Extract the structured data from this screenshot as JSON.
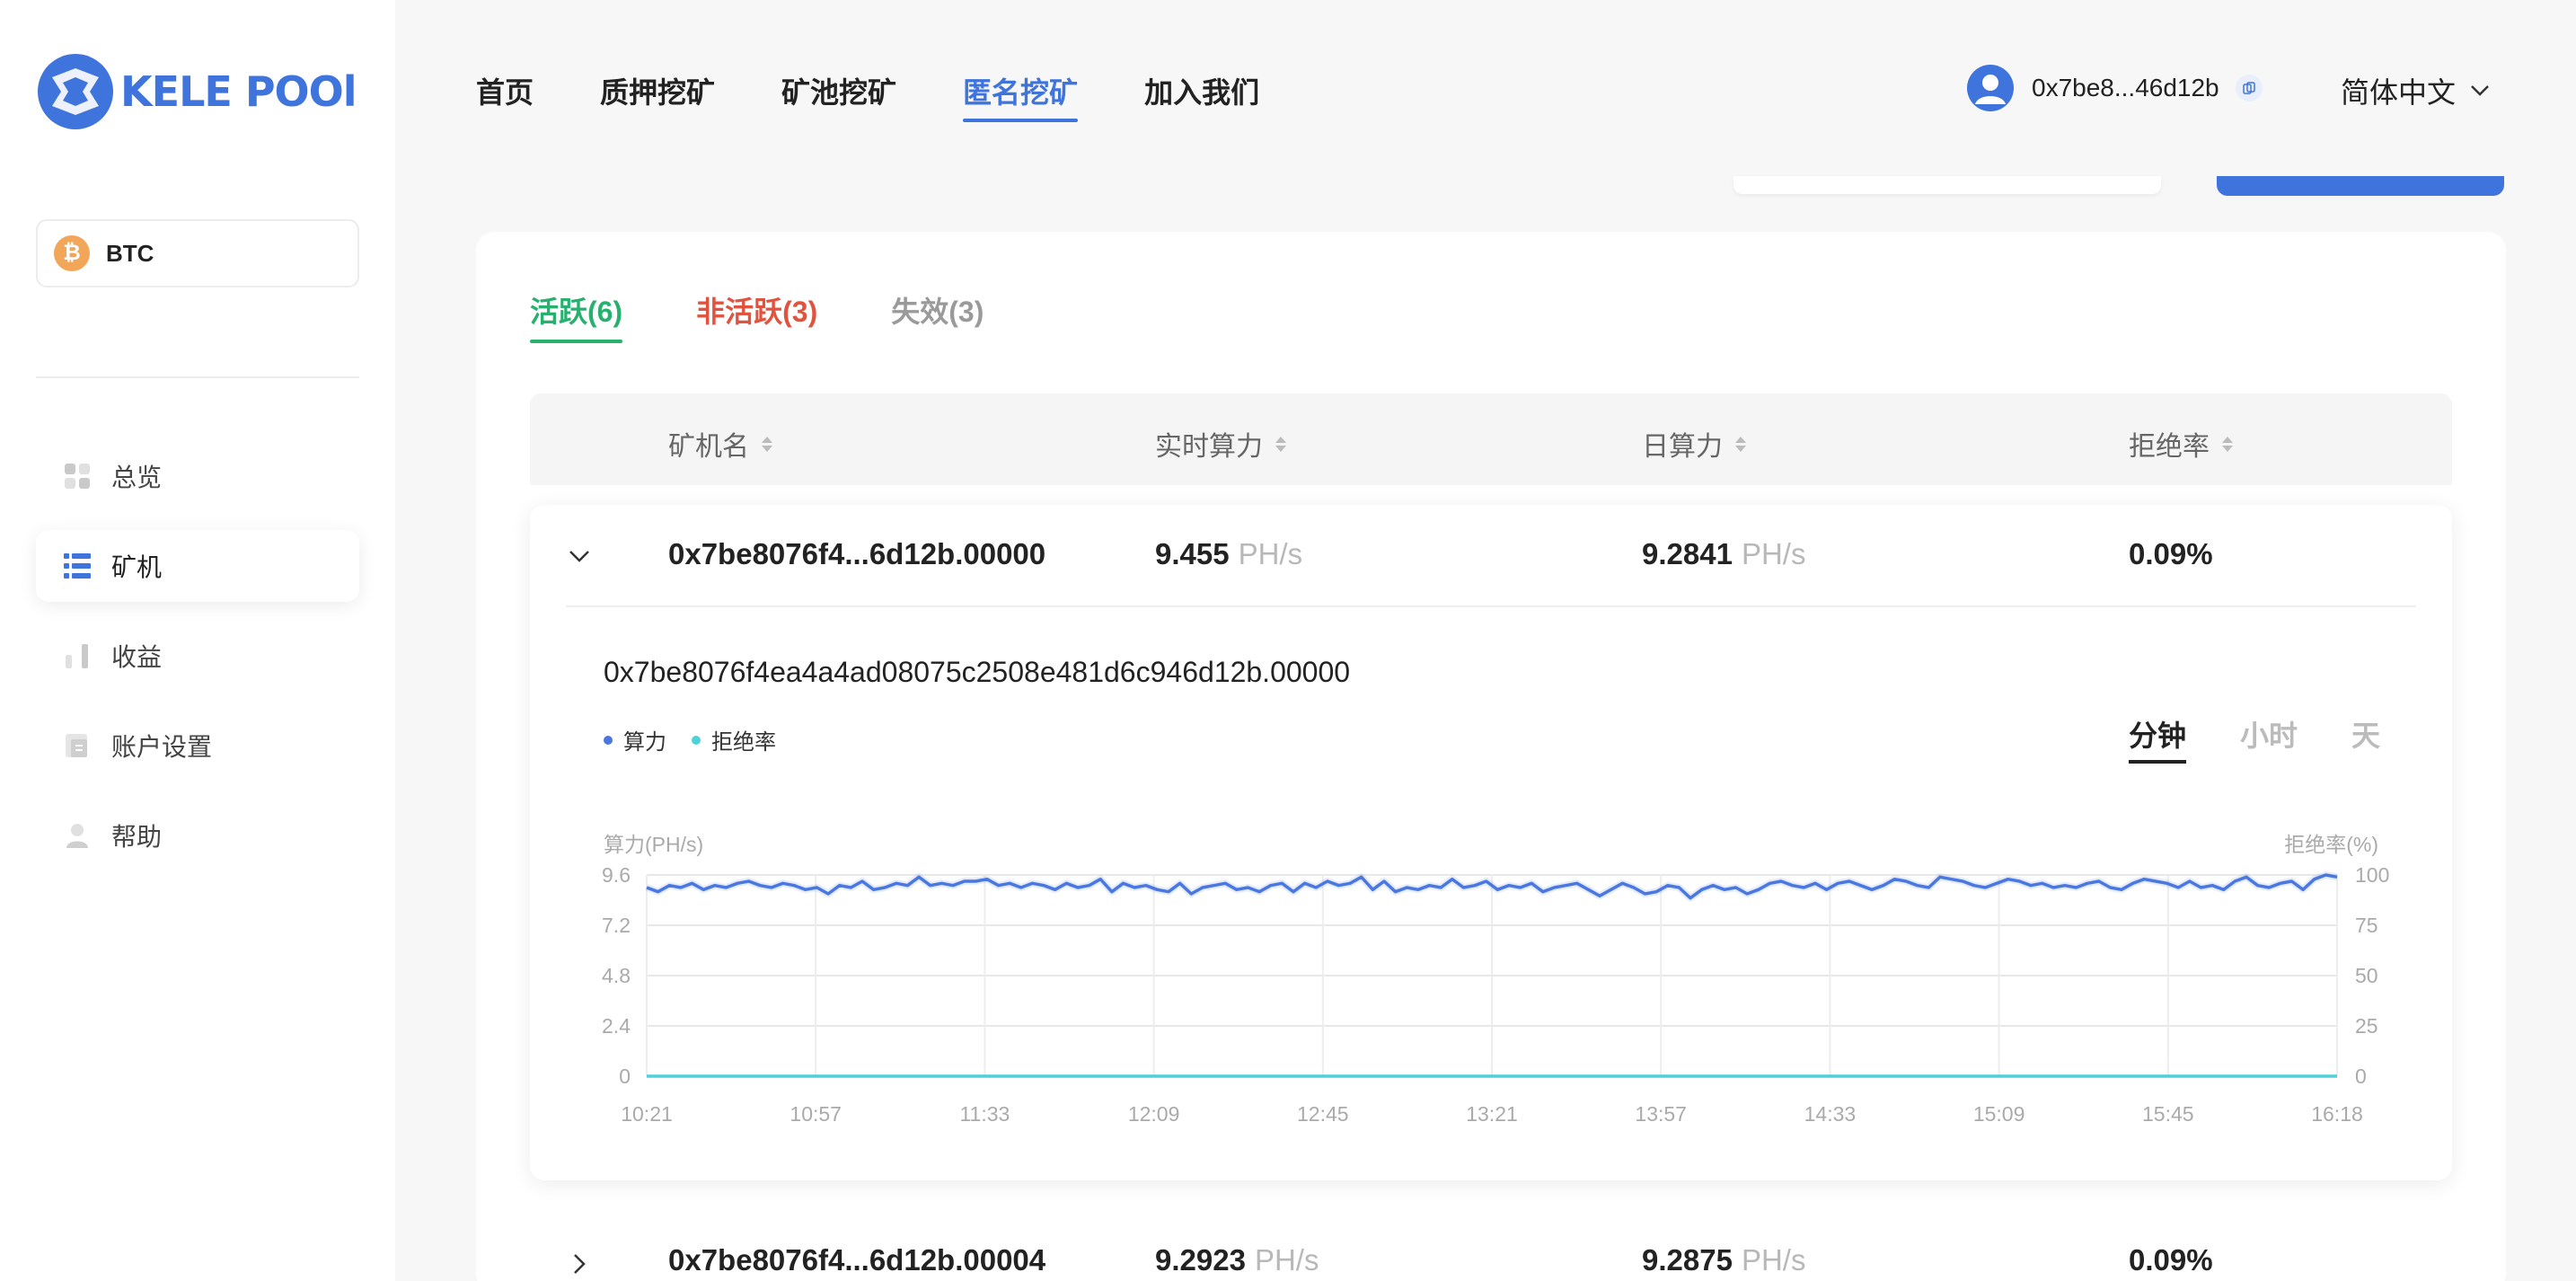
{
  "brand": {
    "name": "KELE POOl"
  },
  "sidebar": {
    "coin": {
      "label": "BTC",
      "icon": "bitcoin-icon"
    },
    "items": [
      {
        "label": "总览",
        "icon": "dashboard-icon",
        "active": false
      },
      {
        "label": "矿机",
        "icon": "list-icon",
        "active": true
      },
      {
        "label": "收益",
        "icon": "bar-chart-icon",
        "active": false
      },
      {
        "label": "账户设置",
        "icon": "settings-icon",
        "active": false
      },
      {
        "label": "帮助",
        "icon": "user-help-icon",
        "active": false
      }
    ]
  },
  "topnav": {
    "items": [
      "首页",
      "质押挖矿",
      "矿池挖矿",
      "匿名挖矿",
      "加入我们"
    ],
    "active_index": 3
  },
  "user": {
    "address": "0x7be8...46d12b"
  },
  "language": {
    "label": "简体中文"
  },
  "tabs": [
    {
      "label": "活跃(6)",
      "color": "#28b06e"
    },
    {
      "label": "非活跃(3)",
      "color": "#e0543f"
    },
    {
      "label": "失效(3)",
      "color": "#9a9a9a"
    }
  ],
  "table": {
    "columns": [
      "矿机名",
      "实时算力",
      "日算力",
      "拒绝率"
    ],
    "rows": [
      {
        "name": "0x7be8076f4...6d12b.00000",
        "realtime": "9.455",
        "realtime_unit": "PH/s",
        "daily": "9.2841",
        "daily_unit": "PH/s",
        "reject": "0.09%",
        "expanded": true
      },
      {
        "name": "0x7be8076f4...6d12b.00004",
        "realtime": "9.2923",
        "realtime_unit": "PH/s",
        "daily": "9.2875",
        "daily_unit": "PH/s",
        "reject": "0.09%",
        "expanded": false
      }
    ]
  },
  "detail": {
    "full_name": "0x7be8076f4ea4a4ad08075c2508e481d6c946d12b.00000",
    "legend": [
      {
        "label": "算力",
        "color": "#4a78e0"
      },
      {
        "label": "拒绝率",
        "color": "#4fd1d9"
      }
    ],
    "periods": [
      "分钟",
      "小时",
      "天"
    ],
    "active_period": 0
  },
  "chart_data": {
    "type": "line",
    "ylabel": "算力(PH/s)",
    "y2label": "拒绝率(%)",
    "ylim": [
      0,
      9.6
    ],
    "y2lim": [
      0,
      100
    ],
    "yticks": [
      "0",
      "2.4",
      "4.8",
      "7.2",
      "9.6"
    ],
    "y2ticks": [
      "0",
      "25",
      "50",
      "75",
      "100"
    ],
    "xticks": [
      "10:21",
      "10:57",
      "11:33",
      "12:09",
      "12:45",
      "13:21",
      "13:57",
      "14:33",
      "15:09",
      "15:45",
      "16:18"
    ],
    "grid": true,
    "series": [
      {
        "name": "算力",
        "color": "#4a78e0",
        "axis": "left",
        "values": [
          9.0,
          8.8,
          9.1,
          9.0,
          9.2,
          8.9,
          9.1,
          9.0,
          9.2,
          9.3,
          9.1,
          9.0,
          9.2,
          9.1,
          8.9,
          9.0,
          8.7,
          9.1,
          9.0,
          9.3,
          8.9,
          9.0,
          9.2,
          9.1,
          9.5,
          9.1,
          9.2,
          9.1,
          9.3,
          9.3,
          9.4,
          9.1,
          9.2,
          9.0,
          9.2,
          9.1,
          8.9,
          9.2,
          9.0,
          9.1,
          9.4,
          8.8,
          9.2,
          9.0,
          9.1,
          8.9,
          8.8,
          9.2,
          8.7,
          9.0,
          9.1,
          9.2,
          8.9,
          9.0,
          8.8,
          9.1,
          9.2,
          8.8,
          9.2,
          9.0,
          9.3,
          9.1,
          9.2,
          9.5,
          8.9,
          9.3,
          8.8,
          9.0,
          8.9,
          9.1,
          9.0,
          9.4,
          9.0,
          9.1,
          9.3,
          8.9,
          9.1,
          9.0,
          9.2,
          8.8,
          9.0,
          9.1,
          9.2,
          8.9,
          8.6,
          8.9,
          9.2,
          9.0,
          8.7,
          8.8,
          9.1,
          9.0,
          8.5,
          8.9,
          9.1,
          8.9,
          9.0,
          8.7,
          8.9,
          9.2,
          9.3,
          9.1,
          9.0,
          9.2,
          8.9,
          9.2,
          9.3,
          9.1,
          8.9,
          9.1,
          9.4,
          9.3,
          9.1,
          9.0,
          9.5,
          9.4,
          9.3,
          9.1,
          9.0,
          9.2,
          9.4,
          9.3,
          9.1,
          9.2,
          9.0,
          9.1,
          9.0,
          9.2,
          9.3,
          9.0,
          8.9,
          9.2,
          9.4,
          9.3,
          9.2,
          9.0,
          9.3,
          9.0,
          9.1,
          8.9,
          9.3,
          9.5,
          9.1,
          9.0,
          9.2,
          9.3,
          8.9,
          9.4,
          9.6,
          9.5
        ]
      },
      {
        "name": "拒绝率",
        "color": "#4fd1d9",
        "axis": "right",
        "values": [
          0,
          0,
          0,
          0,
          0,
          0,
          0,
          0,
          0,
          0,
          0
        ]
      }
    ]
  }
}
